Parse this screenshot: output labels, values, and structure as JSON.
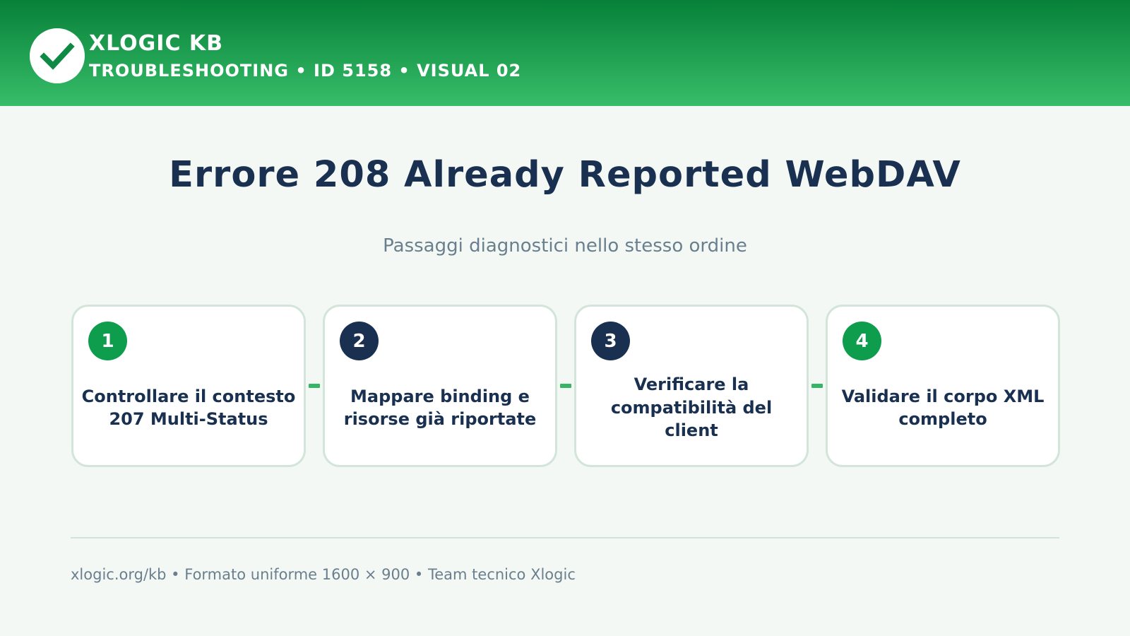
{
  "header": {
    "brand": "XLOGIC KB",
    "breadcrumb": "TROUBLESHOOTING • ID 5158 • VISUAL 02",
    "logo_icon": "check-icon"
  },
  "main": {
    "title": "Errore 208 Already Reported WebDAV",
    "subtitle": "Passaggi diagnostici nello stesso ordine"
  },
  "steps": [
    {
      "number": "1",
      "label": "Controllare il contesto 207 Multi-Status",
      "badge_color": "#0e9d4c"
    },
    {
      "number": "2",
      "label": "Mappare binding e risorse già riportate",
      "badge_color": "#1a3050"
    },
    {
      "number": "3",
      "label": "Verificare la compatibilità del client",
      "badge_color": "#1a3050"
    },
    {
      "number": "4",
      "label": "Validare il corpo XML completo",
      "badge_color": "#0e9d4c"
    }
  ],
  "footer": {
    "text": "xlogic.org/kb • Formato uniforme 1600 × 900 • Team tecnico Xlogic"
  },
  "colors": {
    "header_top": "#078139",
    "header_bottom": "#37bd69",
    "accent_green": "#0e9d4c",
    "navy": "#1a3050",
    "connector": "#37b567"
  }
}
